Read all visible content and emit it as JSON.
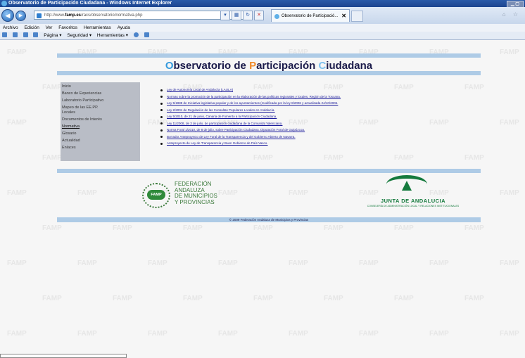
{
  "window": {
    "title": "Observatorio de Participación Ciudadana - Windows Internet Explorer"
  },
  "address": {
    "prefix": "http://www.",
    "host": "famp.es",
    "path": "/racs/observatorio/normativa.php"
  },
  "tab": {
    "label": "Observatorio de Participació..."
  },
  "menu": [
    "Archivo",
    "Edición",
    "Ver",
    "Favoritos",
    "Herramientas",
    "Ayuda"
  ],
  "commands": {
    "page": "Página ▾",
    "security": "Seguridad ▾",
    "tools": "Herramientas ▾"
  },
  "site": {
    "title_parts": [
      {
        "letter": "O",
        "rest": "bservatorio de "
      },
      {
        "letter": "P",
        "rest": "articipación "
      },
      {
        "letter": "C",
        "rest": "iudadana"
      }
    ]
  },
  "sidebar": {
    "items": [
      "Inicio",
      "Banco de Experiencias",
      "Laboratorio Participativo",
      "Mapeo de las EE.PP.",
      "Locales",
      "Documentos de Interés",
      "Normativa",
      "Glosario",
      "Actualidad",
      "Enlaces"
    ],
    "active": "Normativa"
  },
  "links": [
    "Ley de Autonomía Local de Andalucía (LAULA)",
    "Normas sobre la promoción de la participación en la elaboración de las políticas regionales y locales. Región de la Toscana.",
    "Ley 5/1988 de Iniciativa legislativa popular y de los ayuntamientos (modificada por la ley 8/2006 y actualizada 24/10/2006.",
    "Ley 2/2001 de Regulación de las Consultas Populares Locales en Andalucía.",
    "Ley 5/2010, de 21 de junio, Canaria de Fomento a la Participación Ciudadana.",
    "Ley 11/2008, de 3 de julio, de participación ciudadana de la Comunitat Valenciana.",
    "Norma Foral 1/2010, de 8 de julio, sobre Participación Ciudadana. Diputación Foral de Guipúzcoa.",
    "Borrador Anteproyecto de Ley Foral de la Transparencia y del Gobierno Abierto de Navarra.",
    "Anteproyecto de Ley de Transparencia y Buen Gobierno de País Vasco."
  ],
  "footer": {
    "famp_badge": "FAMP",
    "famp_lines": [
      "FEDERACIÓN",
      "ANDALUZA",
      "DE MUNICIPIOS",
      "Y PROVINCIAS"
    ],
    "junta_title": "JUNTA DE ANDALUCIA",
    "junta_sub": "CONSEJERÍA DE ADMINISTRACIÓN LOCAL Y RELACIONES INSTITUCIONALES",
    "copyright": "© 2009 Federación Andaluza de Municipios y Provincias"
  },
  "watermark_text": "FAMP"
}
